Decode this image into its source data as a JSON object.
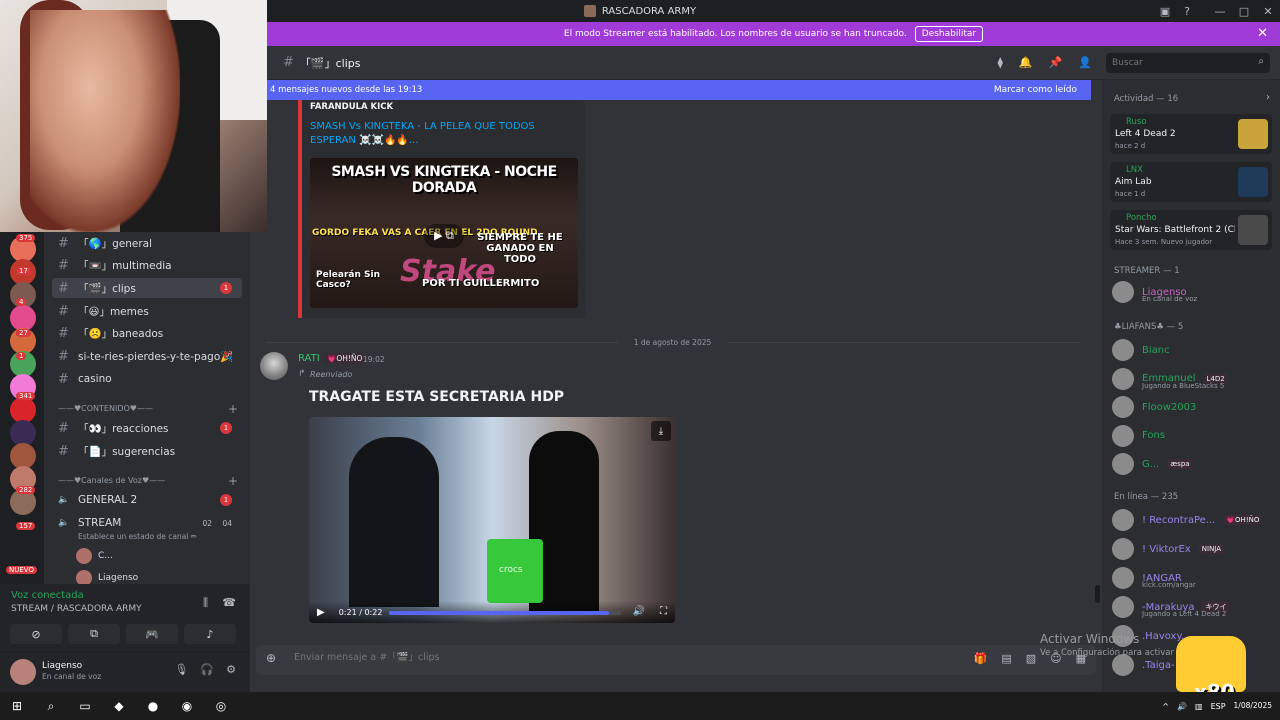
{
  "app": {
    "window_title": "RASCADORA ARMY",
    "streamer_banner": "El modo Streamer está habilitado. Los nombres de usuario se han truncado.",
    "streamer_disable": "Deshabilitar"
  },
  "servers": {
    "badges": [
      "375",
      "17",
      "4",
      "27",
      "1",
      "341",
      "282",
      "157"
    ],
    "new_label": "NUEVO",
    "colors": [
      "#e86f5a",
      "#c0392b",
      "#7d5a50",
      "#e44b8d",
      "#d46a3c",
      "#4aa35a",
      "#f27bd8",
      "#d9252a",
      "#3a2b55",
      "#a0563d",
      "#c07a6b",
      "#8b6b5a"
    ]
  },
  "channels": {
    "text": [
      {
        "name": "「🌎」general",
        "active": false,
        "unread": ""
      },
      {
        "name": "「📼」multimedia",
        "active": false,
        "unread": ""
      },
      {
        "name": "「🎬」clips",
        "active": true,
        "unread": "1"
      },
      {
        "name": "「😃」memes",
        "active": false,
        "unread": ""
      },
      {
        "name": "「☹️」baneados",
        "active": false,
        "unread": ""
      },
      {
        "name": "si-te-ries-pierdes-y-te-pago🎉",
        "active": false,
        "unread": ""
      },
      {
        "name": "casino",
        "active": false,
        "unread": ""
      }
    ],
    "category_content": "——♥CONTENIDO♥——",
    "content": [
      {
        "name": "「👀」reacciones",
        "unread": "1"
      },
      {
        "name": "「📄」sugerencias",
        "unread": ""
      }
    ],
    "category_voice": "——♥Canales de Voz♥——",
    "voice": [
      {
        "name": "GENERAL 2",
        "unread": "1"
      },
      {
        "name": "STREAM",
        "count_left": "02",
        "count_right": "04"
      }
    ],
    "stream_status": "Establece un estado de canal ✏",
    "voice_users": [
      "C...",
      "Liagenso"
    ]
  },
  "voice_panel": {
    "status": "Voz conectada",
    "location": "STREAM / RASCADORA ARMY"
  },
  "user_panel": {
    "name": "Liagenso",
    "status": "En canal de voz"
  },
  "header": {
    "channel": "「🎬」clips",
    "search_placeholder": "Buscar"
  },
  "new_messages": {
    "text": "4 mensajes nuevos desde las 19:13",
    "mark_read": "Marcar como leído"
  },
  "embed": {
    "provider": "FARANDULA KICK",
    "title": "SMASH Vs KINGTEKA - LA PELEA QUE TODOS ESPERAN ☠️☠️🔥🔥...",
    "thumb_headline": "SMASH VS KINGTEKA - NOCHE DORADA",
    "thumb_left": "GORDO FEKA VAS A CAER EN EL 2DO ROUND",
    "thumb_right": "SIEMPRE TE HE GANADO EN TODO",
    "thumb_bottom_left": "Pelearán Sin Casco?",
    "thumb_bottom": "POR TI GUILLERMITO",
    "thumb_brand": "Stake"
  },
  "date_divider": "1 de agosto de 2025",
  "message": {
    "author": "RATI",
    "tag": "💗OH!ÑO",
    "time": "19:02",
    "forwarded": "Reenviado",
    "headline": "TRAGATE ESTA SECRETARIA HDP",
    "video_time": "0:21 / 0:22",
    "video_progress": 0.95,
    "bag_brand": "crocs"
  },
  "composer": {
    "placeholder": "Enviar mensaje a #「🎬」clips"
  },
  "members": {
    "activity_header": "Actividad — 16",
    "activities": [
      {
        "user": "Ruso",
        "game": "Left 4 Dead 2",
        "when": "hace 2 d",
        "color": "#c9a43a"
      },
      {
        "user": "LNX",
        "game": "Aim Lab",
        "when": "hace 1 d",
        "color": "#1f3b5a"
      },
      {
        "user": "Poncho",
        "game": "Star Wars: Battlefront 2 (Cl...",
        "when": "Hace 3 sem.  Nuevo jugador",
        "color": "#4a4a4a"
      }
    ],
    "streamer_header": "STREAMER — 1",
    "streamer": {
      "name": "Liagenso",
      "sub": "En canal de voz"
    },
    "liafans_header": "♣LIAFANS♣ — 5",
    "liafans": [
      {
        "name": "Bianc",
        "sub": "",
        "tag": ""
      },
      {
        "name": "Emmanuel",
        "sub": "Jugando a BlueStacks 5",
        "tag": "L4D2"
      },
      {
        "name": "Floow2003",
        "sub": "",
        "tag": ""
      },
      {
        "name": "Fons",
        "sub": "",
        "tag": ""
      },
      {
        "name": "G...",
        "sub": "",
        "tag": "æspa"
      }
    ],
    "online_header": "En línea — 235",
    "online": [
      {
        "name": "! RecontraPe...",
        "sub": "",
        "tag": "💗OH!ÑO"
      },
      {
        "name": "! ViktorEx",
        "sub": "",
        "tag": "NINJA"
      },
      {
        "name": "!ANGAR",
        "sub": "kick.com/angar",
        "tag": ""
      },
      {
        "name": "-Marakuya",
        "sub": "Jugando a Left 4 Dead 2",
        "tag": "キウイ"
      },
      {
        "name": ".Havoxy.",
        "sub": "",
        "tag": ""
      },
      {
        "name": ".Taiga-",
        "sub": "",
        "tag": ""
      }
    ]
  },
  "overlay": {
    "activate_windows": "Activar Windows",
    "activate_sub": "Ve a Configuración para activar Windows.",
    "multiplier": "x80"
  },
  "taskbar": {
    "lang": "ESP",
    "date": "1/08/2025"
  }
}
